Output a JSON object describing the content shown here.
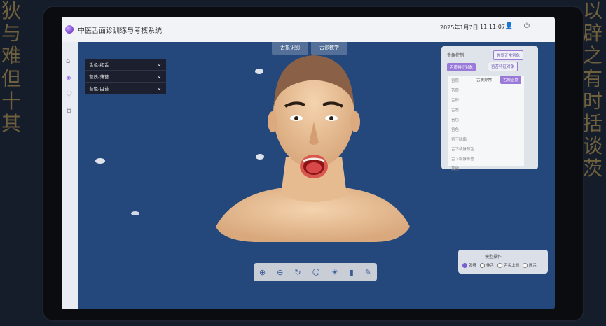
{
  "app": {
    "title": "中医舌面诊训练与考核系统"
  },
  "topbar": {
    "date": "2025年1月7日",
    "time": "11:11:07"
  },
  "tabs": [
    {
      "label": "舌象识别"
    },
    {
      "label": "舌诊教学"
    }
  ],
  "tongue_selects": [
    {
      "label": "舌色-红舌"
    },
    {
      "label": "苔质-薄苔"
    },
    {
      "label": "苔色-白苔"
    }
  ],
  "control_panel": {
    "title": "舌象控制",
    "reset_label": "恢复正常舌象",
    "options": [
      "舌质特征对象",
      "舌苔特征对象"
    ],
    "col_headers": [
      "舌质异常",
      "舌质正常"
    ],
    "items": [
      "舌质",
      "苔质",
      "舌形",
      "舌态",
      "苔色",
      "舌色",
      "舌下脉络",
      "舌下络脉颜色",
      "舌下络脉形态",
      "其他"
    ]
  },
  "toolbar": {
    "icons": [
      "zoom-in-icon",
      "zoom-out-icon",
      "rotate-icon",
      "face-icon",
      "light-icon",
      "bars-icon",
      "brush-icon"
    ]
  },
  "model_ops": {
    "title": "模型操作",
    "options": [
      "张嘴",
      "伸舌",
      "舌尖上翘",
      "闭舌"
    ]
  },
  "calligraphy": {
    "left": [
      "狄",
      "与",
      "难",
      "但",
      "十",
      "其"
    ],
    "right": [
      "以",
      "辟",
      "之",
      "有",
      "时",
      "括",
      "谈",
      "茨"
    ]
  }
}
